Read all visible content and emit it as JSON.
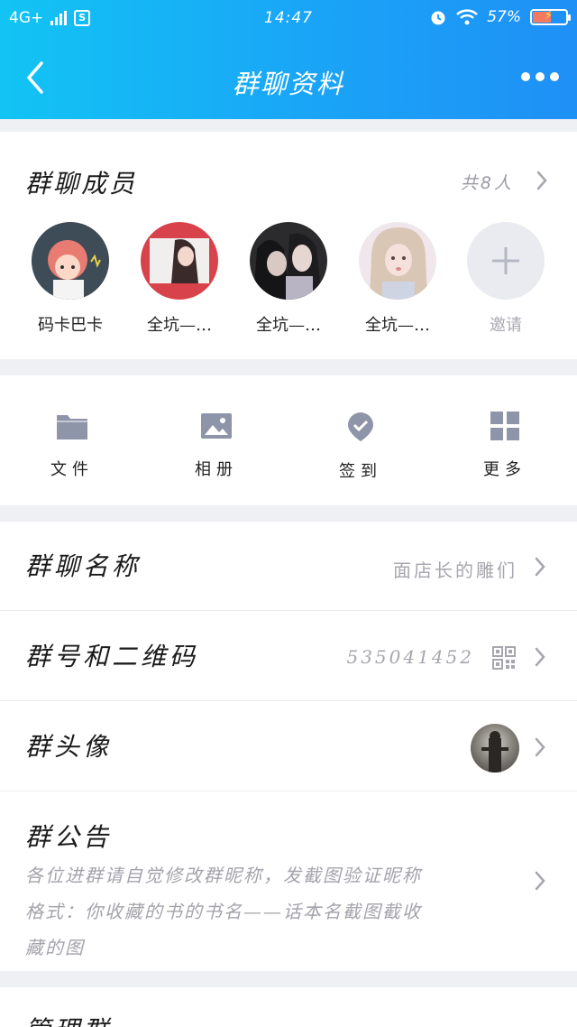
{
  "status_bar": {
    "network": "4G+",
    "sim_badge": "S",
    "time": "14:47",
    "battery_pct": "57%"
  },
  "header": {
    "title": "群聊资料"
  },
  "members_section": {
    "title": "群聊成员",
    "count": "共8人",
    "members": [
      {
        "name": "码卡巴卡"
      },
      {
        "name": "全坑—…"
      },
      {
        "name": "全坑—…"
      },
      {
        "name": "全坑—…"
      }
    ],
    "invite_label": "邀请"
  },
  "features": [
    {
      "label": "文件",
      "icon": "folder-icon"
    },
    {
      "label": "相册",
      "icon": "image-icon"
    },
    {
      "label": "签到",
      "icon": "location-check-icon"
    },
    {
      "label": "更多",
      "icon": "grid-icon"
    }
  ],
  "rows": {
    "group_name": {
      "label": "群聊名称",
      "value": "面店长的雕们"
    },
    "group_id": {
      "label": "群号和二维码",
      "value": "535041452"
    },
    "group_avatar": {
      "label": "群头像"
    },
    "notice": {
      "label": "群公告",
      "text": "各位进群请自觉修改群昵称，发截图验证昵称格式：你收藏的书的书名——话本名截图截收藏的图"
    },
    "manage": {
      "label": "管理群"
    }
  },
  "colors": {
    "header_start": "#12c4f4",
    "header_end": "#1e90f6",
    "icon_gray": "#8f95a8"
  }
}
